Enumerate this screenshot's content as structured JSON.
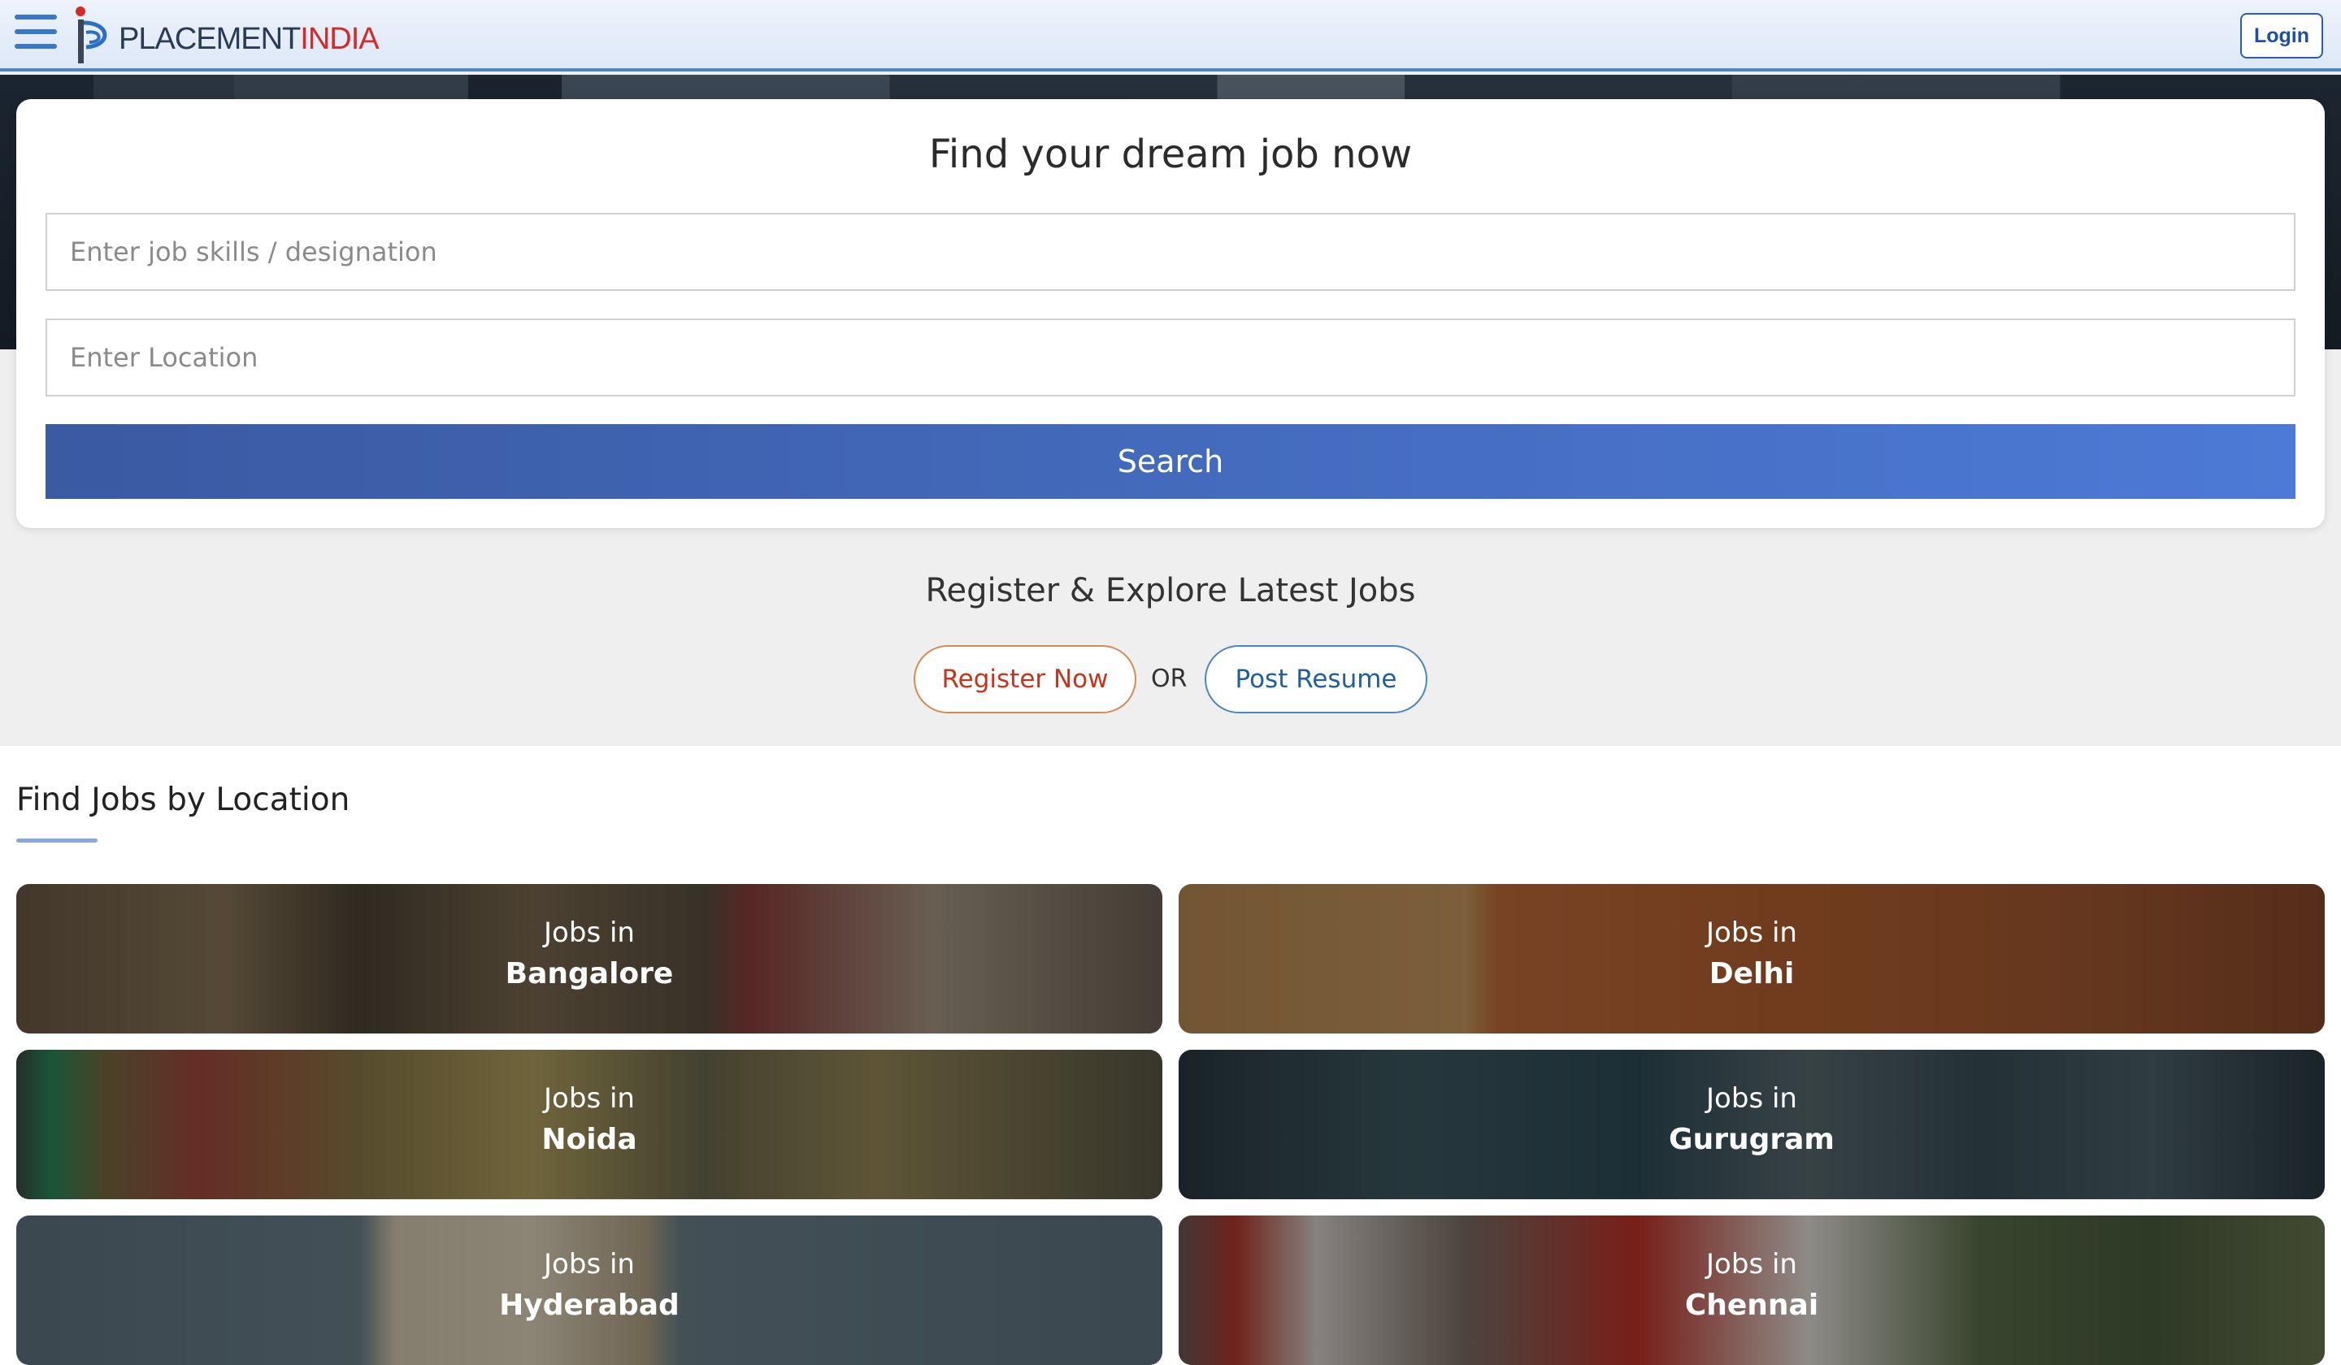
{
  "header": {
    "logo_text_a": "PLACEMENT",
    "logo_text_b": "INDIA",
    "login_label": "Login"
  },
  "search": {
    "title": "Find your dream job now",
    "skills_placeholder": "Enter job skills / designation",
    "location_placeholder": "Enter Location",
    "search_label": "Search"
  },
  "register": {
    "title": "Register & Explore Latest Jobs",
    "register_label": "Register Now",
    "or_label": "OR",
    "post_resume_label": "Post Resume"
  },
  "jobs_by_location": {
    "title": "Find Jobs by Location",
    "prefix": "Jobs in",
    "cities": [
      "Bangalore",
      "Delhi",
      "Noida",
      "Gurugram",
      "Hyderabad",
      "Chennai"
    ]
  },
  "colors": {
    "accent": "#4d7ad6",
    "brand_red": "#d42a2a",
    "register_text": "#c8341a",
    "post_resume_text": "#1f5fa0"
  }
}
